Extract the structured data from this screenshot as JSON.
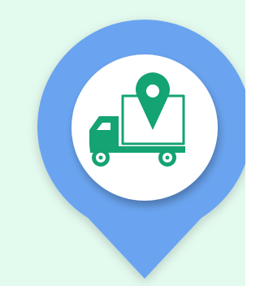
{
  "colors": {
    "background": "#E3FAEE",
    "pin": "#6AA4F0",
    "pin_shadow": "#3F74C4",
    "badge": "#FFFFFF",
    "icon": "#14A372",
    "icon_detail": "#FFFFFF"
  },
  "icons": {
    "pin": "map-pin-icon",
    "truck": "delivery-truck-icon",
    "location": "location-marker-icon"
  }
}
